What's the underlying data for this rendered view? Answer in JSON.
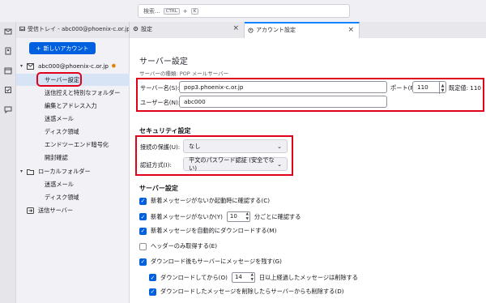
{
  "search": {
    "placeholder": "検索...",
    "shortcut_ctrl": "CTRL",
    "shortcut_plus": "+",
    "shortcut_key": "K"
  },
  "tabs": [
    {
      "label": "受信トレイ - abc000@phoenix-c.or.jp"
    },
    {
      "label": "設定"
    },
    {
      "label": "アカウント設定"
    }
  ],
  "sidebar": {
    "new_account": "新しいアカウント",
    "account": "abc000@phoenix-c.or.jp",
    "items": [
      {
        "label": "サーバー設定"
      },
      {
        "label": "送信控えと特別なフォルダー"
      },
      {
        "label": "編集とアドレス入力"
      },
      {
        "label": "迷惑メール"
      },
      {
        "label": "ディスク領域"
      },
      {
        "label": "エンドツーエンド暗号化"
      },
      {
        "label": "開封確認"
      }
    ],
    "local_folders": "ローカルフォルダー",
    "local_items": [
      {
        "label": "迷惑メール"
      },
      {
        "label": "ディスク領域"
      }
    ],
    "outgoing": "送信サーバー"
  },
  "main": {
    "title": "サーバー設定",
    "server_type": "サーバーの種類: POP メールサーバー",
    "server_name_label": "サーバー名(S):",
    "server_name_value": "pop3.phoenix-c.or.jp",
    "port_label": "ポート(P):",
    "port_value": "110",
    "default_port": "既定値: 110",
    "username_label": "ユーザー名(N):",
    "username_value": "abc000",
    "security_title": "セキュリティ設定",
    "conn_security_label": "接続の保護(U):",
    "conn_security_value": "なし",
    "auth_label": "認証方式(I):",
    "auth_value": "平文のパスワード認証 (安全でない)",
    "server_settings_title": "サーバー設定",
    "check1": "新着メッセージがないか起動時に確認する(C)",
    "check2_pre": "新着メッセージがないか(Y)",
    "check2_value": "10",
    "check2_post": "分ごとに確認する",
    "check3": "新着メッセージを自動的にダウンロードする(M)",
    "check4": "ヘッダーのみ取得する(E)",
    "check5": "ダウンロード後もサーバーにメッセージを残す(G)",
    "check6_pre": "ダウンロードしてから(O)",
    "check6_value": "14",
    "check6_post": "日以上経過したメッセージは削除する",
    "check7": "ダウンロードしたメッセージを削除したらサーバーからも削除する(D)"
  },
  "colors": {
    "accent": "#0060df",
    "annotation": "#e0001a",
    "selection": "#d6e4f5"
  }
}
